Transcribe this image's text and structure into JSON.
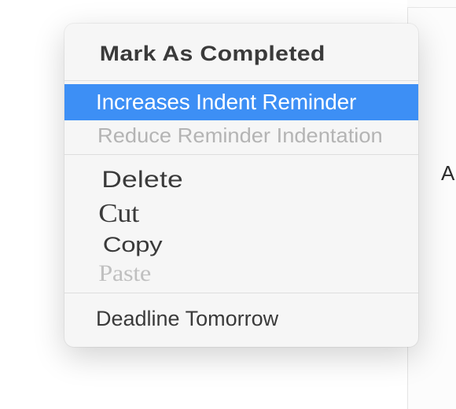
{
  "sidebar": {
    "partial_letter": "A"
  },
  "context_menu": {
    "items": [
      {
        "label": "Mark As Completed",
        "kind": "bold"
      },
      {
        "label": "Increases Indent Reminder",
        "kind": "highlighted"
      },
      {
        "label": "Reduce Reminder Indentation",
        "kind": "disabled"
      },
      {
        "label": "Delete",
        "kind": "distorted-1"
      },
      {
        "label": "Cut",
        "kind": "distorted-2"
      },
      {
        "label": "Copy",
        "kind": "distorted-3"
      },
      {
        "label": "Paste",
        "kind": "distorted-4"
      },
      {
        "label": "Deadline Tomorrow",
        "kind": "deadline"
      }
    ]
  }
}
